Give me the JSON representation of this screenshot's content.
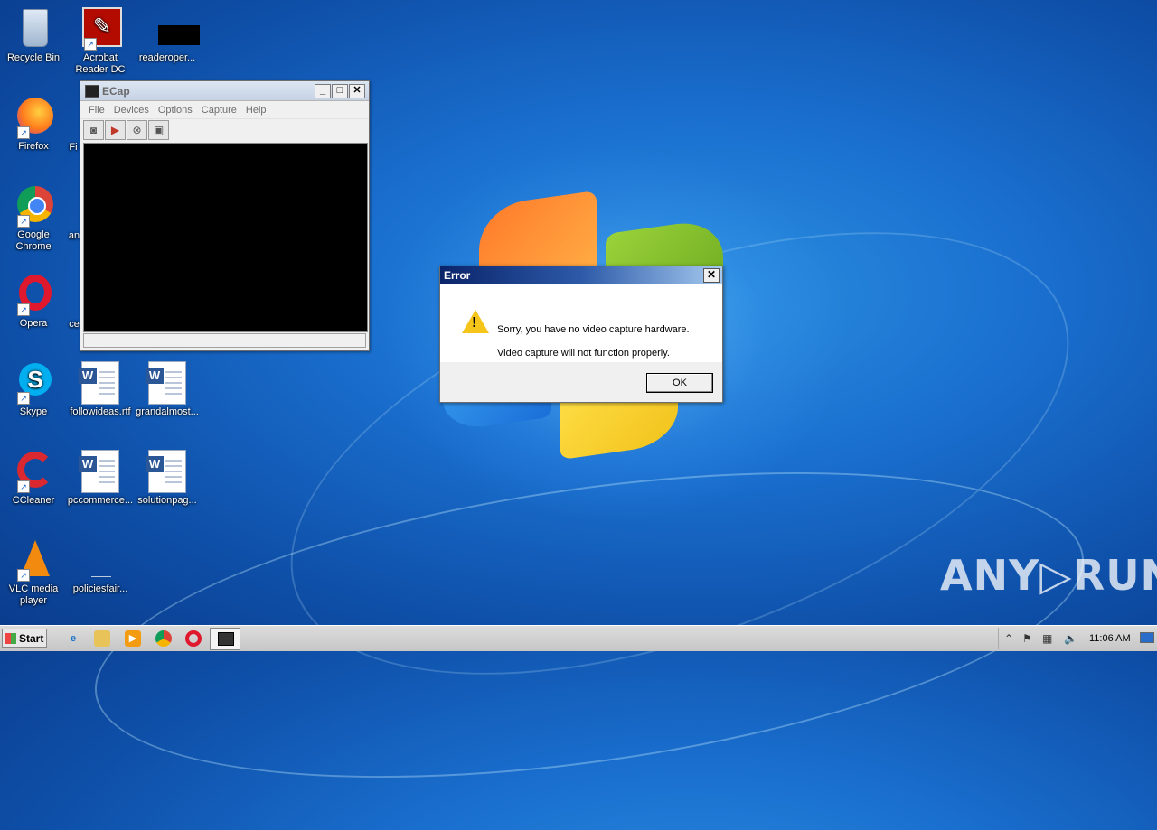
{
  "desktop": {
    "icons": [
      {
        "label": "Recycle Bin",
        "icon": "recycle-bin-icon"
      },
      {
        "label": "Acrobat Reader DC",
        "icon": "acrobat-icon"
      },
      {
        "label": "readeroper...",
        "icon": "file-icon"
      },
      {
        "label": "Firefox",
        "icon": "firefox-icon"
      },
      {
        "label": "Google Chrome",
        "icon": "chrome-icon"
      },
      {
        "label": "Opera",
        "icon": "opera-icon"
      },
      {
        "label": "Skype",
        "icon": "skype-icon"
      },
      {
        "label": "followideas.rtf",
        "icon": "word-doc-icon"
      },
      {
        "label": "grandalmost...",
        "icon": "word-doc-icon"
      },
      {
        "label": "CCleaner",
        "icon": "ccleaner-icon"
      },
      {
        "label": "pccommerce...",
        "icon": "word-doc-icon"
      },
      {
        "label": "solutionpag...",
        "icon": "word-doc-icon"
      },
      {
        "label": "VLC media player",
        "icon": "vlc-icon"
      },
      {
        "label": "policiesfair...",
        "icon": "file-icon"
      },
      {
        "label": "Fi",
        "icon": "partial-icon"
      },
      {
        "label": "an",
        "icon": "partial-icon"
      },
      {
        "label": "ce",
        "icon": "partial-icon"
      }
    ]
  },
  "ecap": {
    "title": "ECap",
    "menu": [
      "File",
      "Devices",
      "Options",
      "Capture",
      "Help"
    ],
    "controls": {
      "minimize": "_",
      "maximize": "□",
      "close": "✕"
    },
    "toolbar": [
      "camera-icon",
      "play-icon",
      "stop-icon",
      "image-icon"
    ]
  },
  "error_dialog": {
    "title": "Error",
    "close": "✕",
    "message1": "Sorry, you have no video capture hardware.",
    "message2": "Video capture will not function properly.",
    "ok_label": "OK"
  },
  "taskbar": {
    "start_label": "Start",
    "clock": "11:06 AM"
  },
  "watermark": "ANY▷RUN"
}
